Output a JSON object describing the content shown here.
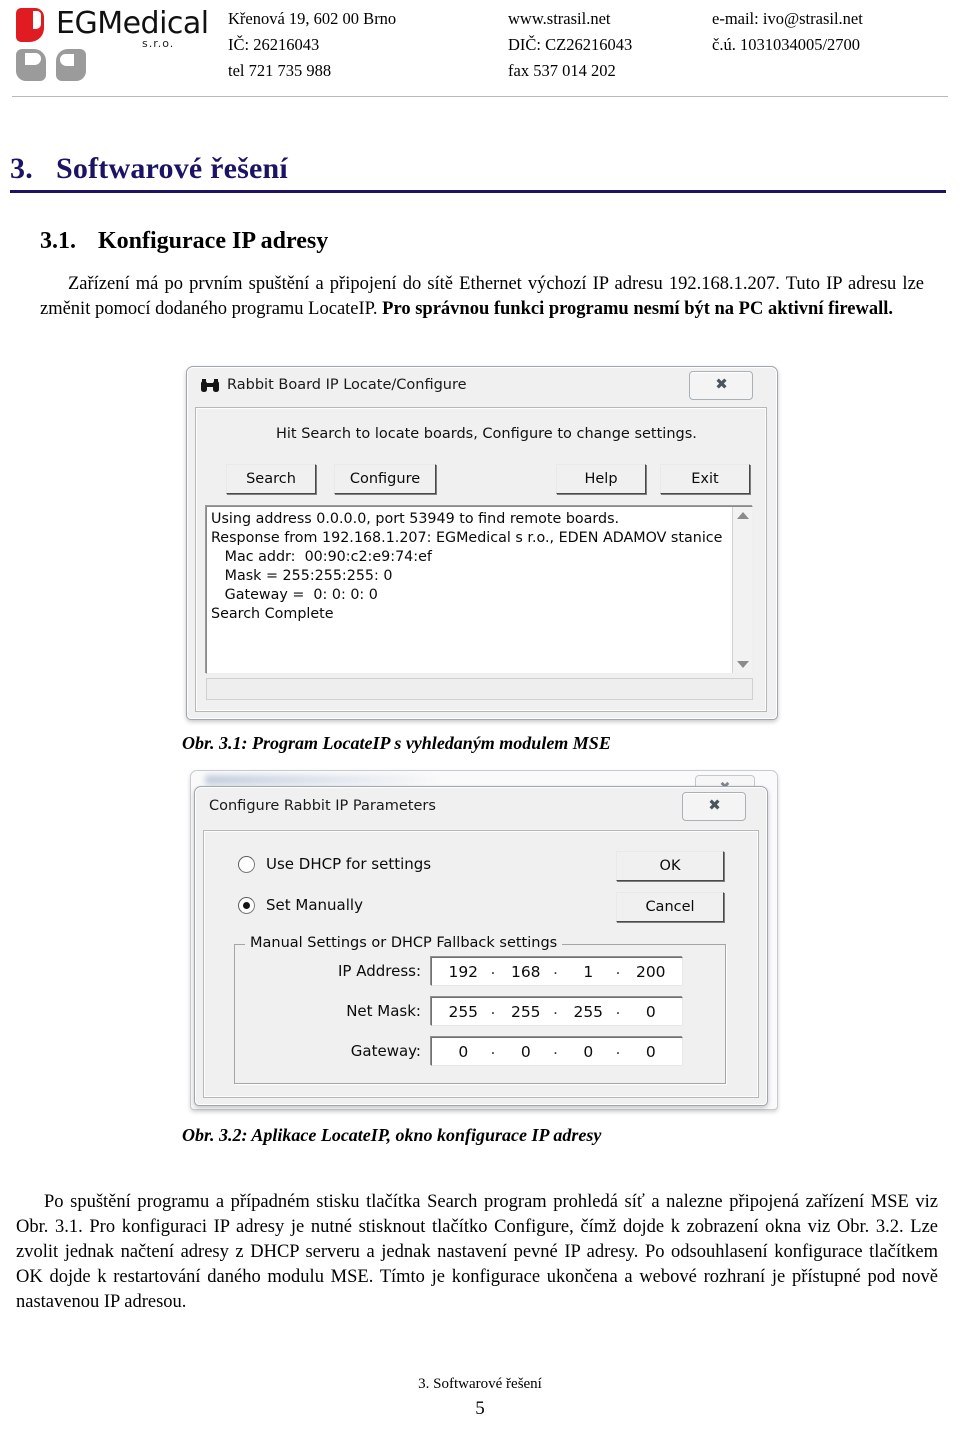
{
  "letterhead": {
    "logo": {
      "wordmark": "EGMedical",
      "suffix": "s.r.o.",
      "red_color": "#e01b22",
      "grey_color": "#9b9b9b"
    },
    "columns": [
      {
        "lines": [
          "Křenová 19, 602 00 Brno",
          "IČ: 26216043",
          "tel 721 735 988"
        ]
      },
      {
        "lines": [
          "www.strasil.net",
          "DIČ: CZ26216043",
          "fax 537 014 202"
        ]
      },
      {
        "lines": [
          "e-mail: ivo@strasil.net",
          "č.ú. 1031034005/2700"
        ]
      }
    ]
  },
  "headings": {
    "h1_number": "3.",
    "h1_text": "Softwarové řešení",
    "h1_color": "#1b1464",
    "h2_number": "3.1.",
    "h2_text": "Konfigurace IP adresy"
  },
  "paragraph_1": {
    "part_a": "Zařízení má po prvním spuštění a připojení do sítě Ethernet výchozí IP adresu 192.168.1.207. Tuto IP adresu lze změnit pomocí dodaného programu LocateIP.",
    "part_bold": "Pro správnou funkci programu nesmí být na PC aktivní firewall."
  },
  "figure_1": {
    "caption": "Obr. 3.1: Program LocateIP s vyhledaným  modulem MSE",
    "dialog": {
      "title": "Rabbit Board IP Locate/Configure",
      "title_icon": "binoculars-icon",
      "close_glyph": "✖",
      "hint": "Hit Search to locate boards, Configure to change settings.",
      "buttons": [
        {
          "label": "Search"
        },
        {
          "label": "Configure"
        },
        {
          "label": "Help"
        },
        {
          "label": "Exit"
        }
      ],
      "log_lines": [
        "Using address 0.0.0.0, port 53949 to find remote boards.",
        "Response from 192.168.1.207: EGMedical s r.o., EDEN ADAMOV stanice",
        "   Mac addr:  00:90:c2:e9:74:ef",
        "   Mask = 255:255:255: 0",
        "   Gateway =  0: 0: 0: 0",
        "Search Complete"
      ],
      "scroll_up": "▲",
      "scroll_down": "▼"
    }
  },
  "figure_2": {
    "caption": "Obr. 3.2: Aplikace LocateIP, okno konfigurace IP adresy",
    "dialog": {
      "title": "Configure Rabbit IP Parameters",
      "close_glyph": "✖",
      "radios": [
        {
          "label": "Use DHCP for settings",
          "checked": false
        },
        {
          "label": "Set Manually",
          "checked": true
        }
      ],
      "buttons": [
        {
          "label": "OK"
        },
        {
          "label": "Cancel"
        }
      ],
      "group_legend": "Manual Settings or DHCP Fallback settings",
      "fields": [
        {
          "label": "IP Address:",
          "octets": [
            "192",
            "168",
            "1",
            "200"
          ]
        },
        {
          "label": "Net Mask:",
          "octets": [
            "255",
            "255",
            "255",
            "0"
          ]
        },
        {
          "label": "Gateway:",
          "octets": [
            "0",
            "0",
            "0",
            "0"
          ]
        }
      ]
    },
    "background_window": {
      "close_glyph": "✖"
    }
  },
  "paragraph_2": {
    "text": "Po spuštění programu a případném stisku tlačítka Search program prohledá síť a nalezne připojená zařízení MSE viz Obr. 3.1. Pro konfiguraci IP adresy je nutné stisknout tlačítko Configure, čímž dojde k zobrazení okna viz Obr. 3.2. Lze zvolit jednak načtení adresy z DHCP serveru a jednak nastavení pevné IP adresy. Po odsouhlasení konfigurace tlačítkem OK dojde k restartování daného modulu MSE. Tímto je konfigurace ukončena a webové rozhraní je přístupné pod nově nastavenou IP adresou."
  },
  "footer": {
    "section": "3. Softwarové řešení",
    "page_number": "5"
  }
}
